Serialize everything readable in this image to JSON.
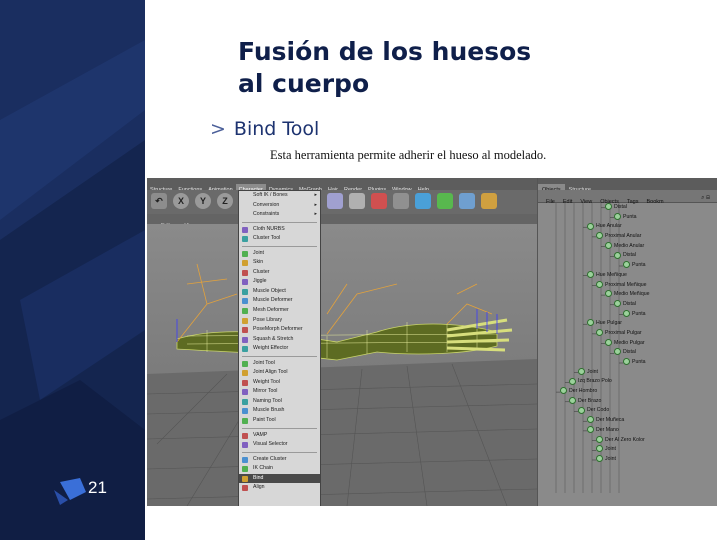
{
  "slide": {
    "number": "21",
    "title_line1": "Fusión de los huesos",
    "title_line2": "al cuerpo",
    "bullet_mark": ">",
    "bullet": "Bind Tool",
    "description": "Esta herramienta permite adherir el hueso al modelado."
  },
  "colors": {
    "sidebar": "#14254f",
    "title": "#0f1f4a",
    "bullet": "#1d3370",
    "menu_bg": "#d7d7d7",
    "viewport": "#7c7c7c"
  },
  "app": {
    "menubar": [
      "Structure",
      "Functions",
      "Animation",
      "Character",
      "Dynamics",
      "MoGraph",
      "Hair",
      "Render",
      "Plugins",
      "Window",
      "Help"
    ],
    "active_menu_index": 3,
    "toolbar": {
      "buttons": [
        "X",
        "Y",
        "Z"
      ],
      "icons": [
        "undo-icon",
        "move-icon",
        "scale-icon",
        "rotate-icon",
        "cube-icon",
        "nurbs-icon",
        "spline-icon",
        "light-icon",
        "camera-icon",
        "deformer-icon",
        "scene-icon",
        "render-icon",
        "render-settings-icon"
      ]
    },
    "viewbar": [
      "Edit",
      "View"
    ],
    "dropdown": [
      {
        "label": "Soft IK / Bones",
        "icon": "none",
        "arrow": true
      },
      {
        "label": "Conversion",
        "icon": "none",
        "arrow": true
      },
      {
        "label": "Constraints",
        "icon": "none",
        "arrow": true
      },
      {
        "sep": true
      },
      {
        "label": "Cloth NURBS",
        "icon": "cloth-icon"
      },
      {
        "label": "Cluster Tool",
        "icon": "cluster-icon"
      },
      {
        "sep": true
      },
      {
        "label": "Joint",
        "icon": "joint-icon"
      },
      {
        "label": "Skin",
        "icon": "skin-icon"
      },
      {
        "label": "Cluster",
        "icon": "cluster-icon"
      },
      {
        "label": "Jiggle",
        "icon": "jiggle-icon"
      },
      {
        "label": "Muscle Object",
        "icon": "muscle-icon"
      },
      {
        "label": "Muscle Deformer",
        "icon": "muscle-deformer-icon"
      },
      {
        "label": "Mesh Deformer",
        "icon": "mesh-deformer-icon"
      },
      {
        "label": "Pose Library",
        "icon": "pose-icon"
      },
      {
        "label": "PoseMorph Deformer",
        "icon": "posemorph-icon"
      },
      {
        "label": "Squash & Stretch",
        "icon": "squash-icon"
      },
      {
        "label": "Weight Effector",
        "icon": "weight-effector-icon"
      },
      {
        "sep": true
      },
      {
        "label": "Joint Tool",
        "icon": "joint-tool-icon"
      },
      {
        "label": "Joint Align Tool",
        "icon": "align-icon"
      },
      {
        "label": "Weight Tool",
        "icon": "weight-icon"
      },
      {
        "label": "Mirror Tool",
        "icon": "mirror-icon"
      },
      {
        "label": "Naming Tool",
        "icon": "naming-icon"
      },
      {
        "label": "Muscle Brush",
        "icon": "brush-icon"
      },
      {
        "label": "Paint Tool",
        "icon": "paint-icon"
      },
      {
        "sep": true
      },
      {
        "label": "VAMP",
        "icon": "vamp-icon"
      },
      {
        "label": "Visual Selector",
        "icon": "selector-icon"
      },
      {
        "sep": true
      },
      {
        "label": "Create Cluster",
        "icon": "create-cluster-icon"
      },
      {
        "label": "IK Chain",
        "icon": "ik-icon"
      },
      {
        "label": "Bind",
        "icon": "bind-icon",
        "selected": true
      },
      {
        "label": "Align",
        "icon": "align-icon"
      }
    ],
    "panel": {
      "tabs": [
        "Objects",
        "Structure"
      ],
      "active_tab": 0,
      "menu": [
        "File",
        "Edit",
        "View",
        "Objects",
        "Tags",
        "Bookm"
      ],
      "tree": [
        {
          "label": "Distal",
          "indent": 7
        },
        {
          "label": "Punta",
          "indent": 8
        },
        {
          "label": "Hue Anular",
          "indent": 5
        },
        {
          "label": "Proximal Anular",
          "indent": 6
        },
        {
          "label": "Medio Anular",
          "indent": 7
        },
        {
          "label": "Distal",
          "indent": 8
        },
        {
          "label": "Punta",
          "indent": 9
        },
        {
          "label": "Hue Meñique",
          "indent": 5
        },
        {
          "label": "Proximal Meñique",
          "indent": 6
        },
        {
          "label": "Medio Meñique",
          "indent": 7
        },
        {
          "label": "Distal",
          "indent": 8
        },
        {
          "label": "Punta",
          "indent": 9
        },
        {
          "label": "Hue Pulgar",
          "indent": 5
        },
        {
          "label": "Proximal Pulgar",
          "indent": 6
        },
        {
          "label": "Medio Pulgar",
          "indent": 7
        },
        {
          "label": "Distal",
          "indent": 8
        },
        {
          "label": "Punta",
          "indent": 9
        },
        {
          "label": "Joint",
          "indent": 4
        },
        {
          "label": "Izq Brazo Polo",
          "indent": 3
        },
        {
          "label": "Der Hombro",
          "indent": 2
        },
        {
          "label": "Der Brazo",
          "indent": 3
        },
        {
          "label": "Der Codo",
          "indent": 4
        },
        {
          "label": "Der Muñeca",
          "indent": 5
        },
        {
          "label": "Der Mano",
          "indent": 5
        },
        {
          "label": "Der Al Zero Kolor",
          "indent": 6
        },
        {
          "label": "Joint",
          "indent": 6
        },
        {
          "label": "Joint",
          "indent": 6
        }
      ]
    }
  }
}
